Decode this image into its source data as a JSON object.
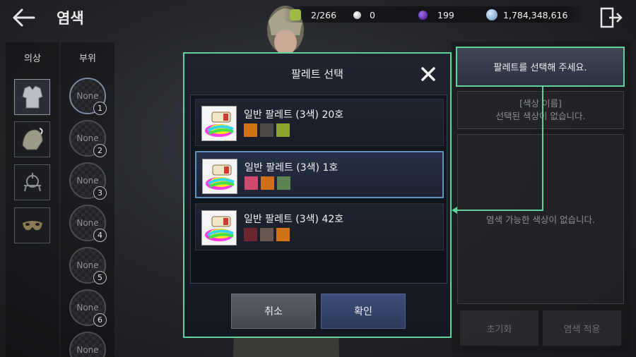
{
  "header": {
    "title": "염색",
    "back_icon": "back-arrow-icon",
    "exit_icon": "exit-door-icon"
  },
  "resources": [
    {
      "icon": "gem-icon",
      "value": "2/266",
      "color": "#b6d25a"
    },
    {
      "icon": "pearl-icon",
      "value": "0",
      "color": "#d8d4d2"
    },
    {
      "icon": "purple-orb-icon",
      "value": "199",
      "color": "#6b2cc0"
    },
    {
      "icon": "silver-coin-icon",
      "value": "1,784,348,616",
      "color": "#8fb8dc"
    }
  ],
  "left_tabs": {
    "costume_header": "의상",
    "parts_header": "부위",
    "costume_slots": [
      {
        "icon": "armor-icon",
        "active": true
      },
      {
        "icon": "helmet-icon",
        "active": false
      },
      {
        "icon": "accessory-icon",
        "active": false
      },
      {
        "icon": "mask-icon",
        "active": false
      }
    ],
    "part_slots": [
      {
        "label": "None",
        "num": "1",
        "active": true
      },
      {
        "label": "None",
        "num": "2"
      },
      {
        "label": "None",
        "num": "3"
      },
      {
        "label": "None",
        "num": "4"
      },
      {
        "label": "None",
        "num": "5"
      },
      {
        "label": "None",
        "num": "6"
      },
      {
        "label": "None",
        "num": ""
      }
    ]
  },
  "right_panel": {
    "hint": "팔레트를 선택해 주세요.",
    "color_name_label": "[색상 이름]",
    "no_selected": "선택된 색상이 없습니다.",
    "no_available": "염색 가능한 색상이 없습니다.",
    "reset_label": "초기화",
    "apply_label": "염색 적용"
  },
  "dialog": {
    "title": "팔레트 선택",
    "close_icon": "close-x-icon",
    "palettes": [
      {
        "name": "일반 팔레트 (3색) 20호",
        "colors": [
          "#d07216",
          "#4e4a45",
          "#8aa52a"
        ],
        "selected": false
      },
      {
        "name": "일반 팔레트 (3색) 1호",
        "colors": [
          "#d0486e",
          "#cf7018",
          "#5e8456"
        ],
        "selected": true
      },
      {
        "name": "일반 팔레트 (3색) 42호",
        "colors": [
          "#6a2630",
          "#6a5750",
          "#d07216"
        ],
        "selected": false
      }
    ],
    "cancel_label": "취소",
    "confirm_label": "확인"
  },
  "accent_color": "#5fd39a"
}
